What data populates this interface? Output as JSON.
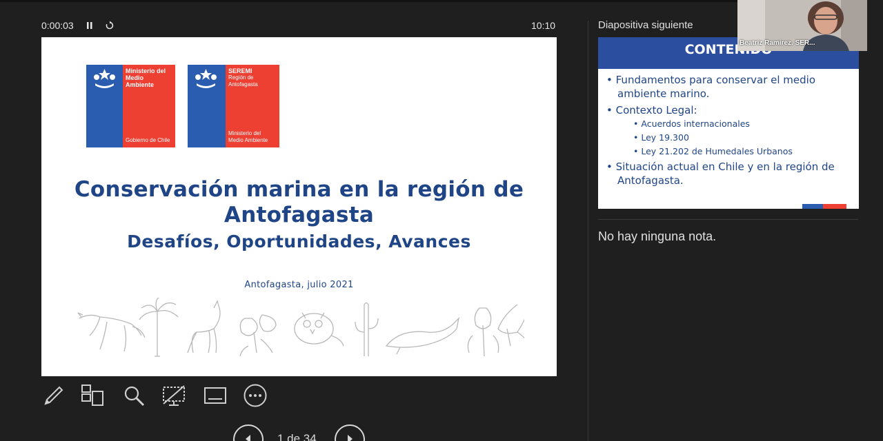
{
  "header": {
    "elapsed": "0:00:03",
    "clock": "10:10",
    "pause_icon": "pause-icon",
    "restart_icon": "restart-icon"
  },
  "slide": {
    "logo1": {
      "line1": "Ministerio del",
      "line2": "Medio",
      "line3": "Ambiente",
      "footer": "Gobierno de Chile"
    },
    "logo2": {
      "line1": "SEREMI",
      "line2": "Región de",
      "line3": "Antofagasta",
      "footer1": "Ministerio del",
      "footer2": "Medio Ambiente"
    },
    "title_line1": "Conservación marina en la región de",
    "title_line2": "Antofagasta",
    "subtitle_line": "Desafíos, Oportunidades, Avances",
    "place_date": "Antofagasta, julio 2021",
    "colors": {
      "title": "#1f4587",
      "blue": "#2a5db0",
      "red": "#ee3f33"
    }
  },
  "tools": {
    "pen": "pen-icon",
    "all_slides": "all-slides-icon",
    "zoom": "zoom-icon",
    "screen": "black-screen-icon",
    "subtitles": "subtitles-icon",
    "more": "more-options-icon"
  },
  "navigation": {
    "page_text": "1 de 34",
    "prev_icon": "previous-arrow-icon",
    "next_icon": "next-arrow-icon"
  },
  "next_panel": {
    "label": "Diapositiva siguiente",
    "header": "CONTENIDO",
    "items": [
      {
        "level": 1,
        "text": "Fundamentos para conservar el medio ambiente marino."
      },
      {
        "level": 1,
        "text": "Contexto Legal:"
      },
      {
        "level": 2,
        "text": "Acuerdos internacionales"
      },
      {
        "level": 2,
        "text": "Ley 19.300"
      },
      {
        "level": 2,
        "text": "Ley 21.202 de Humedales Urbanos"
      },
      {
        "level": 1,
        "text": "Situación actual en Chile y en la región de Antofagasta."
      }
    ]
  },
  "notes": {
    "text": "No hay ninguna nota."
  },
  "webcam": {
    "name": "Beatriz Ramirez. SER..."
  }
}
